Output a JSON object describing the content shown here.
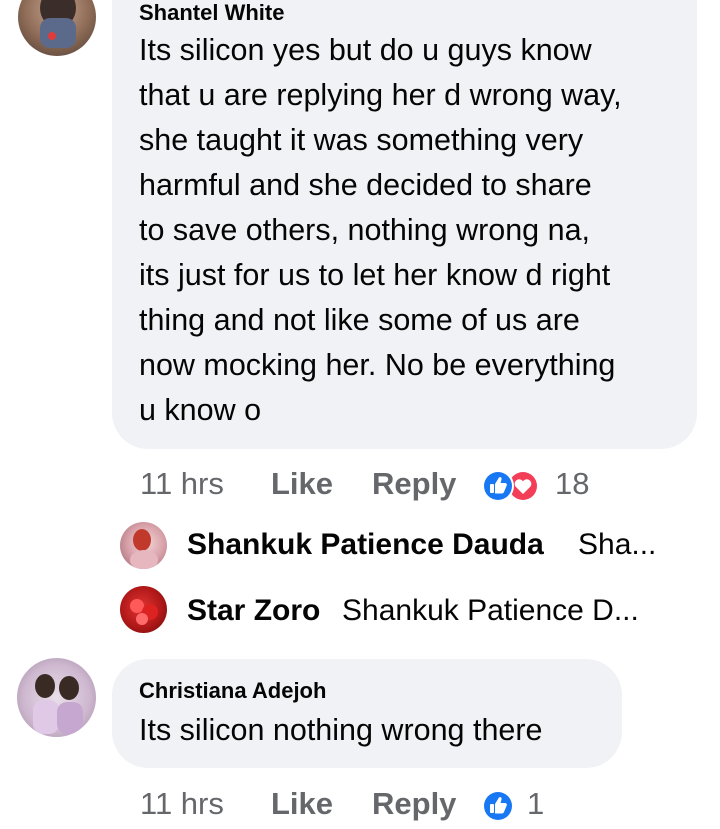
{
  "comments": [
    {
      "author": "Shantel White",
      "text": "Its silicon yes but do u guys know\nthat u are replying her d wrong way,\nshe taught it was something very\nharmful and she decided to share\nto save others, nothing wrong na,\nits just for us to let her know d right\nthing and not like some of us are\nnow mocking her. No be everything\nu know o",
      "time": "11 hrs",
      "like_label": "Like",
      "reply_label": "Reply",
      "reaction_icons": [
        "like-icon",
        "love-icon"
      ],
      "reaction_count": "18",
      "replies": [
        {
          "author": "Shankuk Patience Dauda",
          "snippet": "Sha..."
        },
        {
          "author": "Star Zoro",
          "snippet": "Shankuk Patience D..."
        }
      ]
    },
    {
      "author": "Christiana Adejoh",
      "text": "Its silicon nothing wrong there",
      "time": "11 hrs",
      "like_label": "Like",
      "reply_label": "Reply",
      "reaction_icons": [
        "like-icon"
      ],
      "reaction_count": "1"
    }
  ],
  "colors": {
    "bubble": "#f0f2f5",
    "meta_text": "#65676b",
    "like_blue": "#1877f2",
    "love_red": "#f33e58"
  }
}
